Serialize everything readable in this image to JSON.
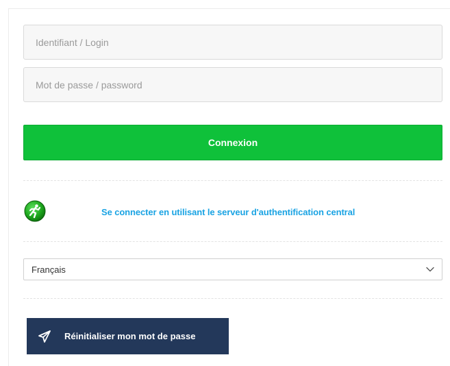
{
  "form": {
    "login_placeholder": "Identifiant / Login",
    "password_placeholder": "Mot de passe / password",
    "connect_label": "Connexion"
  },
  "cas": {
    "link_label": "Se connecter en utilisant le serveur d'authentification central",
    "icon": "running-man-icon"
  },
  "language": {
    "selected": "Français",
    "icon": "chevron-down-icon"
  },
  "reset": {
    "label": "Réinitialiser mon mot de passe",
    "icon": "paper-plane-icon"
  },
  "colors": {
    "connect_button": "#0fc13a",
    "link": "#1aa3e3",
    "reset_button": "#23385a",
    "cas_icon": "#1ea81e"
  }
}
